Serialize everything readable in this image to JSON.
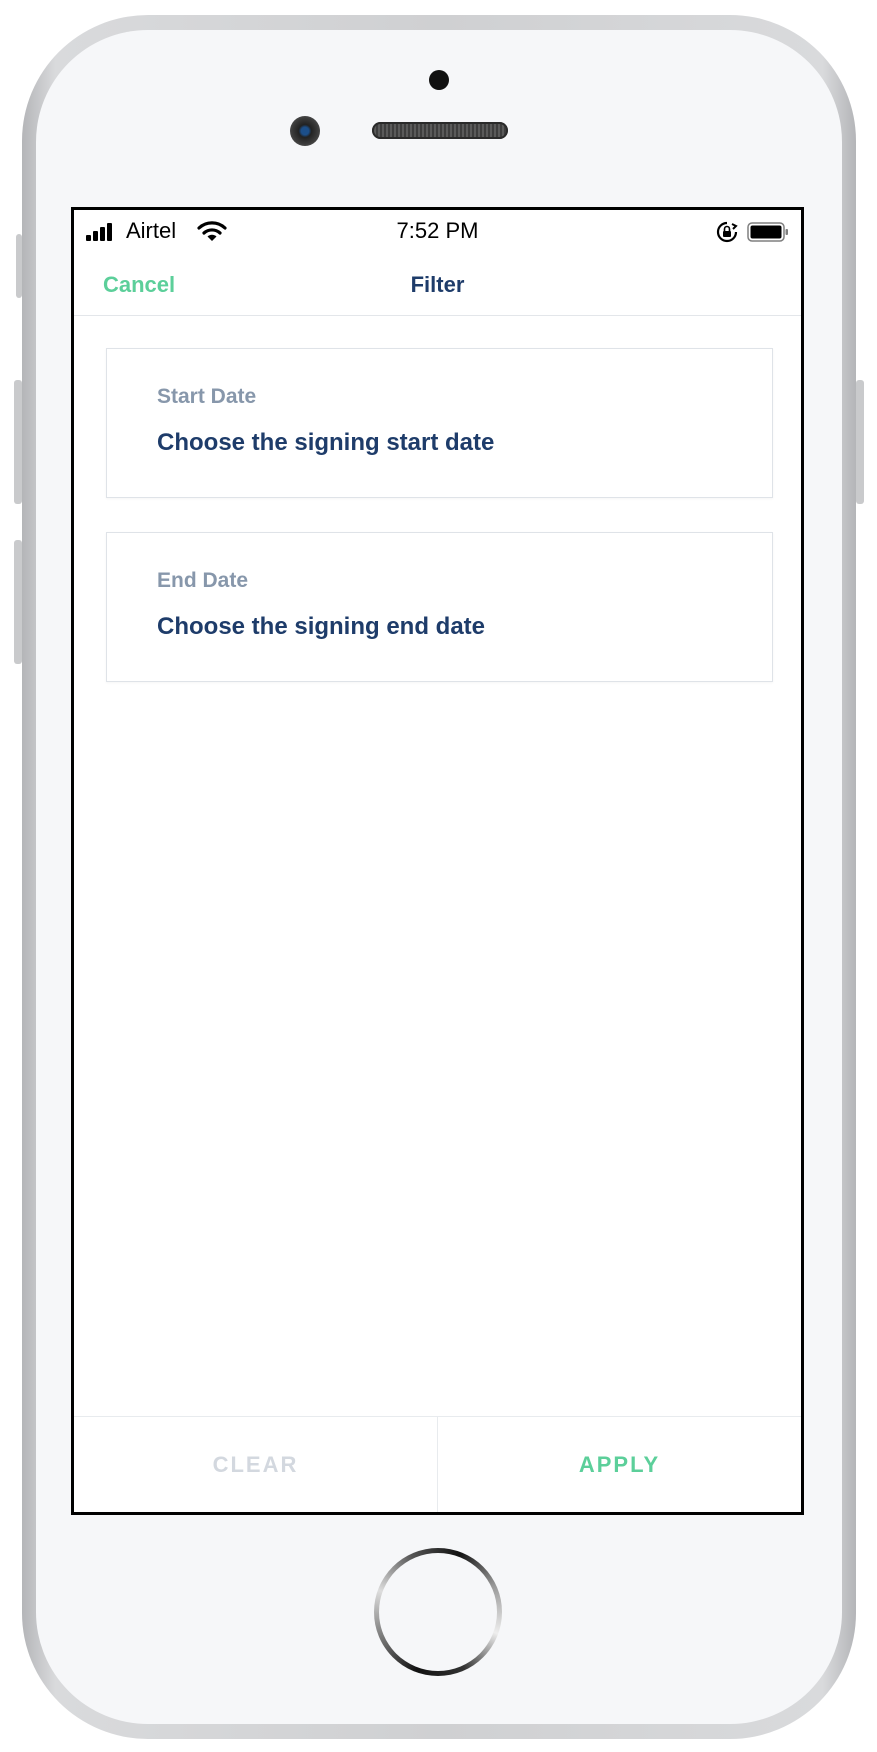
{
  "status_bar": {
    "carrier": "Airtel",
    "time": "7:52 PM",
    "icons": [
      "signal-icon",
      "wifi-icon",
      "rotation-lock-icon",
      "battery-icon"
    ]
  },
  "nav": {
    "cancel_label": "Cancel",
    "title": "Filter"
  },
  "filters": {
    "start": {
      "label": "Start Date",
      "value": "Choose the signing start date"
    },
    "end": {
      "label": "End Date",
      "value": "Choose the signing end date"
    }
  },
  "actions": {
    "clear_label": "CLEAR",
    "apply_label": "APPLY"
  },
  "colors": {
    "accent_green": "#5ccf9a",
    "title_navy": "#1e3c6a",
    "label_gray": "#8797ab",
    "disabled_gray": "#d3d8df"
  }
}
